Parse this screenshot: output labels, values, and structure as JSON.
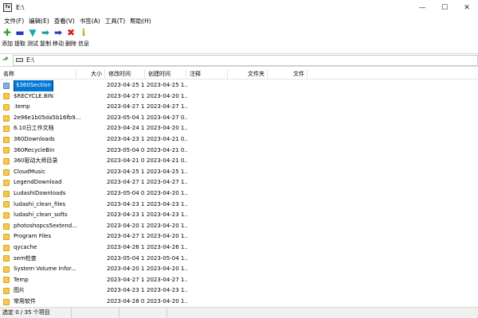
{
  "window": {
    "app_icon_text": "7z",
    "title": "E:\\",
    "min": "—",
    "max": "☐",
    "close": "✕"
  },
  "menu": [
    "文件(F)",
    "编辑(E)",
    "查看(V)",
    "书签(A)",
    "工具(T)",
    "帮助(H)"
  ],
  "toolbar": [
    {
      "label": "添加",
      "icon": "add-icon",
      "glyph": "✚",
      "color": "#2ea02e"
    },
    {
      "label": "提取",
      "icon": "extract-icon",
      "glyph": "▬",
      "color": "#1f3fbf"
    },
    {
      "label": "测试",
      "icon": "test-icon",
      "glyph": "▼",
      "color": "#1aa7b5"
    },
    {
      "label": "复制",
      "icon": "copy-icon",
      "glyph": "➡",
      "color": "#1a9c8a"
    },
    {
      "label": "移动",
      "icon": "move-icon",
      "glyph": "➡",
      "color": "#1f3fbf"
    },
    {
      "label": "删除",
      "icon": "delete-icon",
      "glyph": "✖",
      "color": "#d11a1a"
    },
    {
      "label": "信息",
      "icon": "info-icon",
      "glyph": "i",
      "color": "#c9a800"
    }
  ],
  "address": {
    "path": "E:\\"
  },
  "columns": {
    "name": "名称",
    "size": "大小",
    "modified": "修改时间",
    "created": "创建时间",
    "comment": "注释",
    "folders": "文件夹",
    "files": "文件"
  },
  "files": [
    {
      "name": "$360Section",
      "modified": "2023-04-25 1...",
      "created": "2023-04-25 1...",
      "selected": true,
      "type": "sys"
    },
    {
      "name": "$RECYCLE.BIN",
      "modified": "2023-04-27 1...",
      "created": "2023-04-20 1..."
    },
    {
      "name": ".temp",
      "modified": "2023-04-27 1...",
      "created": "2023-04-27 1..."
    },
    {
      "name": "2e96e1b05da5b16fb9...",
      "modified": "2023-05-04 1...",
      "created": "2023-04-27 0..."
    },
    {
      "name": "6.10日工作文档",
      "modified": "2023-04-24 1...",
      "created": "2023-04-20 1..."
    },
    {
      "name": "360Downloads",
      "modified": "2023-04-23 1...",
      "created": "2023-04-21 0..."
    },
    {
      "name": "360RecycleBin",
      "modified": "2023-05-04 0...",
      "created": "2023-04-21 0..."
    },
    {
      "name": "360驱动大师目录",
      "modified": "2023-04-21 0...",
      "created": "2023-04-21 0..."
    },
    {
      "name": "CloudMusic",
      "modified": "2023-04-25 1...",
      "created": "2023-04-25 1..."
    },
    {
      "name": "LegendDownload",
      "modified": "2023-04-27 1...",
      "created": "2023-04-27 1..."
    },
    {
      "name": "LudashiDownloads",
      "modified": "2023-05-04 0...",
      "created": "2023-04-20 1..."
    },
    {
      "name": "ludashi_clean_files",
      "modified": "2023-04-23 1...",
      "created": "2023-04-23 1..."
    },
    {
      "name": "ludashi_clean_softs",
      "modified": "2023-04-23 1...",
      "created": "2023-04-23 1..."
    },
    {
      "name": "photoshopcs5extend...",
      "modified": "2023-04-20 1...",
      "created": "2023-04-20 1..."
    },
    {
      "name": "Program Files",
      "modified": "2023-04-27 1...",
      "created": "2023-04-20 1..."
    },
    {
      "name": "qycache",
      "modified": "2023-04-26 1...",
      "created": "2023-04-26 1..."
    },
    {
      "name": "sem检查",
      "modified": "2023-05-04 1...",
      "created": "2023-05-04 1..."
    },
    {
      "name": "System Volume Infor...",
      "modified": "2023-04-20 1...",
      "created": "2023-04-20 1..."
    },
    {
      "name": "Temp",
      "modified": "2023-04-27 1...",
      "created": "2023-04-27 1..."
    },
    {
      "name": "图片",
      "modified": "2023-04-23 1...",
      "created": "2023-04-23 1..."
    },
    {
      "name": "常用软件",
      "modified": "2023-04-28 0...",
      "created": "2023-04-20 1..."
    }
  ],
  "status": {
    "text": "选定 0 / 35 个项目"
  }
}
